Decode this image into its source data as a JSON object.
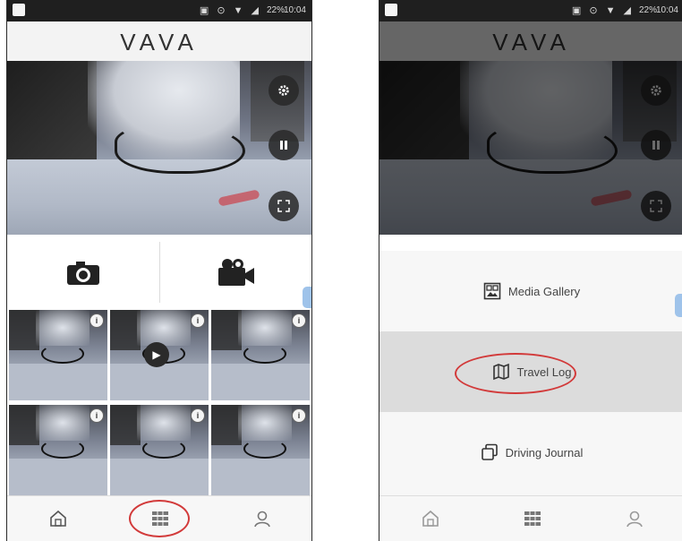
{
  "app": {
    "logo": "VAVA"
  },
  "status_bar": {
    "battery": "22%",
    "left_time": "10:04",
    "right_time": "10:04"
  },
  "left_screen": {
    "preview_caption": "",
    "buttons": {
      "settings_icon": "gear-icon",
      "pause_icon": "pause-icon",
      "fullscreen_icon": "fullscreen-icon"
    },
    "actions": [
      {
        "name": "take-photo",
        "icon": "camera-icon"
      },
      {
        "name": "record-video",
        "icon": "video-camera-icon"
      }
    ],
    "thumbnails": [
      {
        "type": "photo"
      },
      {
        "type": "video"
      },
      {
        "type": "photo"
      },
      {
        "type": "photo"
      },
      {
        "type": "photo"
      },
      {
        "type": "photo"
      }
    ],
    "nav": [
      {
        "name": "home",
        "icon": "home-icon"
      },
      {
        "name": "gallery",
        "icon": "grid-icon",
        "highlighted": true
      },
      {
        "name": "profile",
        "icon": "user-icon"
      }
    ]
  },
  "right_screen": {
    "menu": [
      {
        "label": "Media Gallery",
        "icon": "media-gallery-icon",
        "selected": false
      },
      {
        "label": "Travel Log",
        "icon": "map-icon",
        "selected": true
      },
      {
        "label": "Driving Journal",
        "icon": "journal-icon",
        "selected": false
      }
    ],
    "nav": [
      {
        "name": "home",
        "icon": "home-icon"
      },
      {
        "name": "gallery",
        "icon": "grid-icon"
      },
      {
        "name": "profile",
        "icon": "user-icon"
      }
    ]
  },
  "colors": {
    "highlight_ellipse": "#d23a3a",
    "selected_row": "#dcdcdc"
  }
}
